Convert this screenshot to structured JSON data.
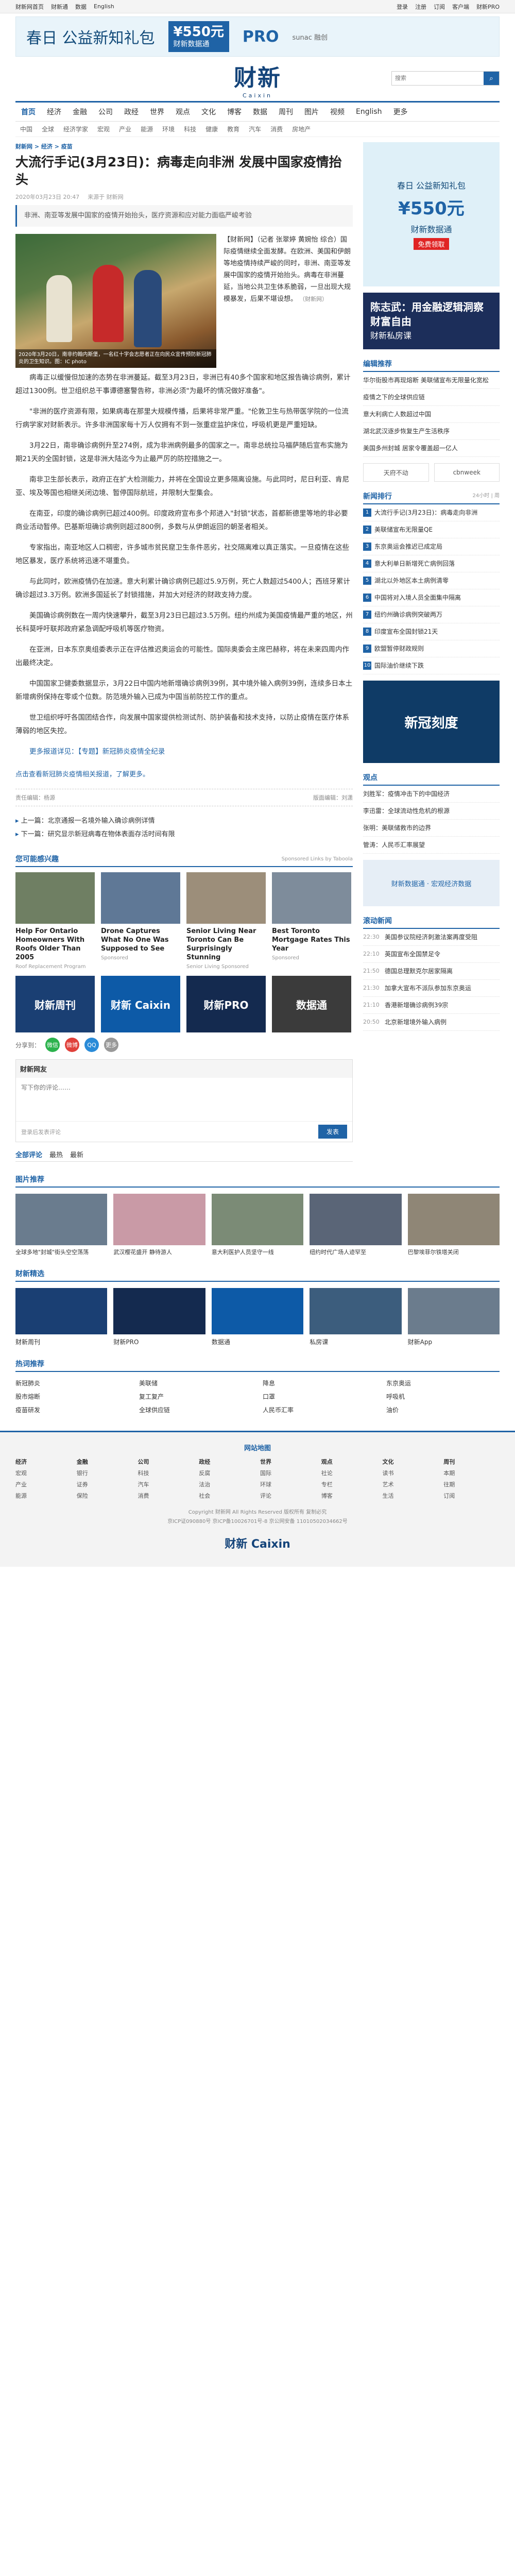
{
  "topbar": {
    "left": [
      "财新网首页",
      "财新通",
      "数据",
      "English"
    ],
    "right": [
      "登录",
      "注册",
      "订阅",
      "客户端",
      "财新PRO"
    ]
  },
  "ad_top": {
    "text1": "春日 公益新知礼包",
    "price": "¥550元",
    "price_sub": "财新数据通",
    "pro": "PRO",
    "brand": "sunac 融创"
  },
  "logo": {
    "cn": "财新",
    "en": "Caixin"
  },
  "search": {
    "placeholder": "搜索"
  },
  "nav": [
    "首页",
    "经济",
    "金融",
    "公司",
    "政经",
    "世界",
    "观点",
    "文化",
    "博客",
    "数据",
    "周刊",
    "图片",
    "视频",
    "English",
    "更多"
  ],
  "subnav": [
    "中国",
    "全球",
    "经济学家",
    "宏观",
    "产业",
    "能源",
    "环境",
    "科技",
    "健康",
    "教育",
    "汽车",
    "消费",
    "房地产"
  ],
  "article": {
    "crumb": "财新网 > 经济 > 疫苗",
    "title": "大流行手记(3月23日)：病毒走向非洲 发展中国家疫情抬头",
    "meta_date": "2020年03月23日 20:47",
    "meta_source": "来源于 财新网",
    "summary": "非洲、南亚等发展中国家的疫情开始抬头，医疗资源和应对能力面临严峻考验",
    "photo_caption": "2020年3月20日，南非约翰内斯堡，一名红十字会志愿者正在向民众宣传预防新冠肺炎的卫生知识。图：IC photo",
    "fig_text": "【财新网】（记者 张翠婷 黄婉怡 综合）国际疫情继续全面发酵。在欧洲、美国和伊朗等地疫情持续严峻的同时，非洲、南亚等发展中国家的疫情开始抬头。病毒在非洲蔓延，当地公共卫生体系脆弱，一旦出现大规模暴发，后果不堪设想。",
    "fig_src": "（财新网）",
    "paragraphs": [
      "病毒正以缓慢但加速的态势在非洲蔓延。截至3月23日，非洲已有40多个国家和地区报告确诊病例，累计超过1300例。世卫组织总干事谭德塞警告称，非洲必须\"为最坏的情况做好准备\"。",
      "\"非洲的医疗资源有限，如果病毒在那里大规模传播，后果将非常严重。\"伦敦卫生与热带医学院的一位流行病学家对财新表示。许多非洲国家每十万人仅拥有不到一张重症监护床位，呼吸机更是严重短缺。",
      "3月22日，南非确诊病例升至274例，成为非洲病例最多的国家之一。南非总统拉马福萨随后宣布实施为期21天的全国封锁，这是非洲大陆迄今为止最严厉的防控措施之一。",
      "南非卫生部长表示，政府正在扩大检测能力，并将在全国设立更多隔离设施。与此同时，尼日利亚、肯尼亚、埃及等国也相继关闭边境、暂停国际航班，并限制大型集会。",
      "在南亚，印度的确诊病例已超过400例。印度政府宣布多个邦进入\"封锁\"状态，首都新德里等地的非必要商业活动暂停。巴基斯坦确诊病例则超过800例，多数与从伊朗返回的朝圣者相关。",
      "专家指出，南亚地区人口稠密，许多城市贫民窟卫生条件恶劣，社交隔离难以真正落实。一旦疫情在这些地区暴发，医疗系统将迅速不堪重负。",
      "与此同时，欧洲疫情仍在加速。意大利累计确诊病例已超过5.9万例，死亡人数超过5400人；西班牙累计确诊超过3.3万例。欧洲多国延长了封锁措施，并加大对经济的财政支持力度。",
      "美国确诊病例数在一周内快速攀升，截至3月23日已超过3.5万例。纽约州成为美国疫情最严重的地区，州长科莫呼吁联邦政府紧急调配呼吸机等医疗物资。",
      "在亚洲，日本东京奥组委表示正在评估推迟奥运会的可能性。国际奥委会主席巴赫称，将在未来四周内作出最终决定。",
      "中国国家卫健委数据显示，3月22日中国内地新增确诊病例39例，其中境外输入病例39例，连续多日本土新增病例保持在零或个位数。防范境外输入已成为中国当前防控工作的重点。",
      "世卫组织呼吁各国团结合作，向发展中国家提供检测试剂、防护装备和技术支持，以防止疫情在医疗体系薄弱的地区失控。"
    ],
    "highlight": "更多报道详见：【专题】新冠肺炎疫情全纪录",
    "pager": "点击查看新冠肺炎疫情相关报道，了解更多。",
    "editor": "责任编辑：杨源",
    "copyright": "版面编辑：刘潇",
    "related": [
      "上一篇：北京通报一名境外输入确诊病例详情",
      "下一篇：研究显示新冠病毒在物体表面存活时间有限"
    ]
  },
  "sponsored": {
    "title": "您可能感兴趣",
    "tag": "Sponsored Links by Taboola",
    "cards": [
      {
        "t": "Help For Ontario Homeowners With Roofs Older Than 2005",
        "s": "Roof Replacement Program"
      },
      {
        "t": "Drone Captures What No One Was Supposed to See",
        "s": "Sponsored"
      },
      {
        "t": "Senior Living Near Toronto Can Be Surprisingly Stunning",
        "s": "Senior Living Sponsored"
      },
      {
        "t": "Best Toronto Mortgage Rates This Year",
        "s": "Sponsored"
      }
    ]
  },
  "promo": [
    {
      "label": "财新周刊",
      "color": "#1a3f73"
    },
    {
      "label": "财新 Caixin",
      "color": "#0d5aa7"
    },
    {
      "label": "财新PRO",
      "color": "#142a4f"
    },
    {
      "label": "数据通",
      "color": "#3b3b3b"
    }
  ],
  "share_label": "分享到：",
  "share": [
    "微信",
    "微博",
    "QQ",
    "更多"
  ],
  "comment": {
    "title": "财新网友",
    "placeholder": "写下你的评论……",
    "login": "登录后发表评论",
    "submit": "发表"
  },
  "tabs": [
    "全部评论",
    "最热",
    "最新"
  ],
  "sidebar": {
    "ad1_text": "春日 公益新知礼包",
    "ad1_price": "¥550元",
    "ad1_sub": "财新数据通",
    "ad1_free": "免费领取",
    "ad2_title": "陈志武：用金融逻辑洞察财富自由",
    "ad2_sub": "财新私房课",
    "hot_title": "编辑推荐",
    "hot": [
      "华尔街股市再现熔断 美联储宣布无限量化宽松",
      "疫情之下的全球供应链",
      "意大利病亡人数超过中国",
      "湖北武汉逐步恢复生产生活秩序",
      "美国多州封城 居家令覆盖超一亿人"
    ],
    "partners": [
      "天府不动",
      "cbnweek"
    ],
    "rank_title": "新闻排行",
    "rank_tabs": "24小时 | 周",
    "rank": [
      "大流行手记(3月23日)：病毒走向非洲",
      "美联储宣布无限量QE",
      "东京奥运会推迟已成定局",
      "意大利单日新增死亡病例回落",
      "湖北以外地区本土病例清零",
      "中国将对入境人员全面集中隔离",
      "纽约州确诊病例突破两万",
      "印度宣布全国封锁21天",
      "欧盟暂停财政规则",
      "国际油价继续下跌"
    ],
    "blue_box": "新冠刻度",
    "col_title": "观点",
    "cols": [
      "刘胜军：疫情冲击下的中国经济",
      "李迅雷：全球流动性危机的根源",
      "张明：美联储救市的边界",
      "管涛：人民币汇率展望"
    ],
    "box2": "财新数据通 · 宏观经济数据",
    "live_title": "滚动新闻",
    "live": [
      {
        "tm": "22:30",
        "t": "美国参议院经济刺激法案再度受阻"
      },
      {
        "tm": "22:10",
        "t": "英国宣布全国禁足令"
      },
      {
        "tm": "21:50",
        "t": "德国总理默克尔居家隔离"
      },
      {
        "tm": "21:30",
        "t": "加拿大宣布不派队参加东京奥运"
      },
      {
        "tm": "21:10",
        "t": "香港新增确诊病例39宗"
      },
      {
        "tm": "20:50",
        "t": "北京新增境外输入病例"
      }
    ]
  },
  "gallery": {
    "title": "图片推荐",
    "items": [
      "全球多地\"封城\"街头空空荡荡",
      "武汉樱花盛开 静待游人",
      "意大利医护人员坚守一线",
      "纽约时代广场人迹罕至",
      "巴黎埃菲尔铁塔关闭"
    ]
  },
  "picks": {
    "title": "财新精选",
    "items": [
      "财新周刊",
      "财新PRO",
      "数据通",
      "私房课",
      "财新App"
    ]
  },
  "news": {
    "title": "热词推荐",
    "items": [
      "新冠肺炎",
      "美联储",
      "降息",
      "东京奥运",
      "股市熔断",
      "复工复产",
      "口罩",
      "呼吸机",
      "疫苗研发",
      "全球供应链",
      "人民币汇率",
      "油价"
    ]
  },
  "footer": {
    "title": "网站地图",
    "cols": [
      {
        "h": "经济",
        "i": [
          "宏观",
          "产业",
          "能源"
        ]
      },
      {
        "h": "金融",
        "i": [
          "银行",
          "证券",
          "保险"
        ]
      },
      {
        "h": "公司",
        "i": [
          "科技",
          "汽车",
          "消费"
        ]
      },
      {
        "h": "政经",
        "i": [
          "反腐",
          "法治",
          "社会"
        ]
      },
      {
        "h": "世界",
        "i": [
          "国际",
          "环球",
          "评论"
        ]
      },
      {
        "h": "观点",
        "i": [
          "社论",
          "专栏",
          "博客"
        ]
      },
      {
        "h": "文化",
        "i": [
          "读书",
          "艺术",
          "生活"
        ]
      },
      {
        "h": "周刊",
        "i": [
          "本期",
          "往期",
          "订阅"
        ]
      }
    ],
    "copyright": "Copyright 财新网 All Rights Reserved 版权所有 复制必究",
    "icp": "京ICP证090880号 京ICP备10026701号-8 京公网安备 11010502034662号",
    "bottom_logo": "财新 Caixin"
  }
}
